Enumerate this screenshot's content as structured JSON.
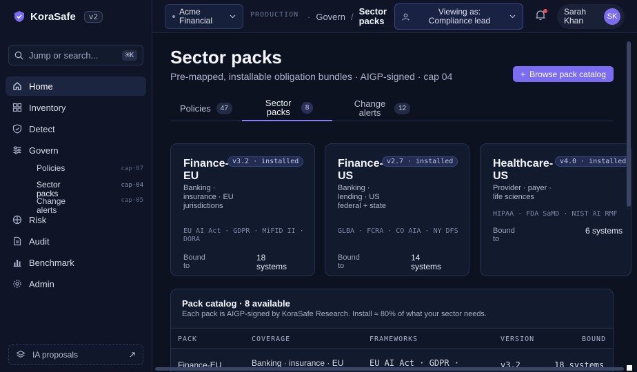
{
  "app": {
    "name": "KoraSafe",
    "version": "v2"
  },
  "search": {
    "placeholder": "Jump or search...",
    "shortcut": "⌘K"
  },
  "sidebar": {
    "items": [
      {
        "label": "Home",
        "icon": "home-icon",
        "active": true
      },
      {
        "label": "Inventory",
        "icon": "grid-icon"
      },
      {
        "label": "Detect",
        "icon": "shield-icon"
      },
      {
        "label": "Govern",
        "icon": "sliders-icon"
      },
      {
        "label": "Risk",
        "icon": "crosshair-icon"
      },
      {
        "label": "Audit",
        "icon": "document-icon"
      },
      {
        "label": "Benchmark",
        "icon": "bar-chart-icon"
      },
      {
        "label": "Admin",
        "icon": "gear-icon"
      }
    ],
    "govern_sub": [
      {
        "label": "Policies",
        "cap": "cap·07"
      },
      {
        "label": "Sector packs",
        "cap": "cap·04"
      },
      {
        "label": "Change alerts",
        "cap": "cap·05"
      }
    ],
    "ia_proposals": "IA proposals"
  },
  "topbar": {
    "org": "Acme Financial",
    "env": "PRODUCTION",
    "breadcrumb": [
      "Govern",
      "Sector packs"
    ],
    "viewing_as": "Viewing as: Compliance lead",
    "user": {
      "name": "Sarah Khan",
      "initials": "SK"
    }
  },
  "page": {
    "title": "Sector packs",
    "subtitle": "Pre-mapped, installable obligation bundles · AIGP-signed · cap 04",
    "browse_button": "Browse pack catalog"
  },
  "tabs": [
    {
      "label": "Policies",
      "count": "47"
    },
    {
      "label": "Sector packs",
      "count": "8",
      "active": true
    },
    {
      "label": "Change alerts",
      "count": "12"
    }
  ],
  "cards": [
    {
      "name": "Finance-EU",
      "badge": "v3.2 · installed",
      "desc": "Banking · insurance · EU jurisdictions",
      "frameworks": "EU AI Act · GDPR · MiFID II · DORA",
      "bound_label": "Bound to",
      "bound_value": "18 systems"
    },
    {
      "name": "Finance-US",
      "badge": "v2.7 · installed",
      "desc": "Banking · lending · US federal + state",
      "frameworks": "GLBA · FCRA · CO AIA · NY DFS",
      "bound_label": "Bound to",
      "bound_value": "14 systems"
    },
    {
      "name": "Healthcare-US",
      "badge": "v4.0 · installed",
      "desc": "Provider · payer · life sciences",
      "frameworks": "HIPAA · FDA SaMD · NIST AI RMF",
      "bound_label": "Bound to",
      "bound_value": "6 systems"
    }
  ],
  "catalog": {
    "title": "Pack catalog · 8 available",
    "subtitle": "Each pack is AIGP-signed by KoraSafe Research. Install ≈ 80% of what your sector needs.",
    "columns": [
      "PACK",
      "COVERAGE",
      "FRAMEWORKS",
      "VERSION",
      "BOUND"
    ],
    "first_row": [
      "Finance-EU",
      "Banking · insurance · EU",
      "EU AI Act · GDPR ·",
      "v3.2",
      "18 systems"
    ]
  }
}
